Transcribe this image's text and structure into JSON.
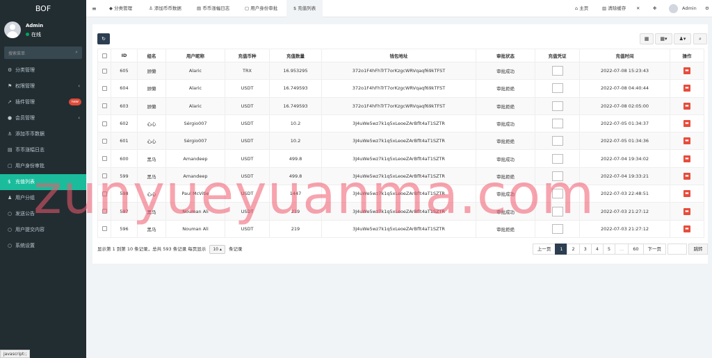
{
  "sidebar": {
    "logo": "BOF",
    "user_name": "Admin",
    "user_status": "在线",
    "search_placeholder": "搜索菜单",
    "items": [
      {
        "label": "分类管理",
        "icon": "cog-icon"
      },
      {
        "label": "权限管理",
        "icon": "group-icon",
        "arrow": true
      },
      {
        "label": "插件管理",
        "icon": "rocket-icon",
        "badge": "new"
      },
      {
        "label": "会员管理",
        "icon": "user-icon",
        "arrow": true
      },
      {
        "label": "添加币币数据",
        "icon": "anchor-icon"
      },
      {
        "label": "币币涨幅日志",
        "icon": "table-icon"
      },
      {
        "label": "用户身份审批",
        "icon": "list-icon"
      },
      {
        "label": "充值列表",
        "icon": "dollar-icon",
        "active": true
      },
      {
        "label": "用户分组",
        "icon": "users-icon"
      },
      {
        "label": "发送公告",
        "icon": "circle-icon"
      },
      {
        "label": "用户提交内容",
        "icon": "circle-icon"
      },
      {
        "label": "系统设置",
        "icon": "circle-icon"
      }
    ]
  },
  "topbar": {
    "tabs": [
      "分类管理",
      "添加币币数据",
      "币币涨幅日志",
      "用户身份审批",
      "充值列表"
    ],
    "home": "主页",
    "clear_cache": "清除缓存",
    "admin": "Admin"
  },
  "table": {
    "headers": [
      "ID",
      "组名",
      "用户昵称",
      "充值币种",
      "充值数量",
      "钱包地址",
      "审批状态",
      "充值凭证",
      "充值时间",
      "操作"
    ],
    "rows": [
      {
        "id": "605",
        "group": "顾懒",
        "nick": "Alaric",
        "coin": "TRX",
        "amount": "16.953295",
        "wallet": "372o1F4hFhTrT7orKzgcWRVqaqf69kTFST",
        "status": "审批成功",
        "time": "2022-07-08 15:23:43"
      },
      {
        "id": "604",
        "group": "顾懒",
        "nick": "Alaric",
        "coin": "USDT",
        "amount": "16.749593",
        "wallet": "372o1F4hFhTrT7orKzgcWRVqaqf69kTFST",
        "status": "审批拒绝",
        "time": "2022-07-08 04:40:44"
      },
      {
        "id": "603",
        "group": "顾懒",
        "nick": "Alaric",
        "coin": "USDT",
        "amount": "16.749593",
        "wallet": "372o1F4hFhTrT7orKzgcWRVqaqf69kTFST",
        "status": "审批拒绝",
        "time": "2022-07-08 02:05:00"
      },
      {
        "id": "602",
        "group": "心心",
        "nick": "Sérgio007",
        "coin": "USDT",
        "amount": "10.2",
        "wallet": "3J4uWe5wz7k1q5xLeoeZArBflt4aT1SZTR",
        "status": "审批成功",
        "time": "2022-07-05 01:34:37"
      },
      {
        "id": "601",
        "group": "心心",
        "nick": "Sérgio007",
        "coin": "USDT",
        "amount": "10.2",
        "wallet": "3J4uWe5wz7k1q5xLeoeZArBflt4aT1SZTR",
        "status": "审批拒绝",
        "time": "2022-07-05 01:34:36"
      },
      {
        "id": "600",
        "group": "黑马",
        "nick": "Amandeep",
        "coin": "USDT",
        "amount": "499.8",
        "wallet": "3J4uWe5wz7k1q5xLeoeZArBflt4aT1SZTR",
        "status": "审批成功",
        "time": "2022-07-04 19:34:02"
      },
      {
        "id": "599",
        "group": "黑马",
        "nick": "Amandeep",
        "coin": "USDT",
        "amount": "499.8",
        "wallet": "3J4uWe5wz7k1q5xLeoeZArBflt4aT1SZTR",
        "status": "审批拒绝",
        "time": "2022-07-04 19:33:21"
      },
      {
        "id": "598",
        "group": "心心",
        "nick": "Paul McVitie",
        "coin": "USDT",
        "amount": "1447",
        "wallet": "3J4uWe5wz7k1q5xLeoeZArBflt4aT1SZTR",
        "status": "审批成功",
        "time": "2022-07-03 22:48:51"
      },
      {
        "id": "597",
        "group": "黑马",
        "nick": "Nouman Ali",
        "coin": "USDT",
        "amount": "219",
        "wallet": "3J4uWe5wz7k1q5xLeoeZArBflt4aT1SZTR",
        "status": "审批成功",
        "time": "2022-07-03 21:27:12"
      },
      {
        "id": "596",
        "group": "黑马",
        "nick": "Nouman Ali",
        "coin": "USDT",
        "amount": "219",
        "wallet": "3J4uWe5wz7k1q5xLeoeZArBflt4aT1SZTR",
        "status": "审批拒绝",
        "time": "2022-07-03 21:27:12"
      }
    ]
  },
  "pagination": {
    "info_prefix": "显示第 1 到第 10 条记录，总共 593 条记录 每页显示",
    "page_size": "10",
    "info_suffix": "条记录",
    "prev": "上一页",
    "pages": [
      "1",
      "2",
      "3",
      "4",
      "5",
      "...",
      "60"
    ],
    "next": "下一页",
    "jump": "跳转"
  },
  "status_bar": "javascript:;",
  "watermark": "zunyueyuanma.com",
  "colors": {
    "sidebar_bg": "#222d32",
    "active_green": "#1abc9c",
    "danger": "#e74c3c",
    "dark_button": "#2c3e50"
  }
}
